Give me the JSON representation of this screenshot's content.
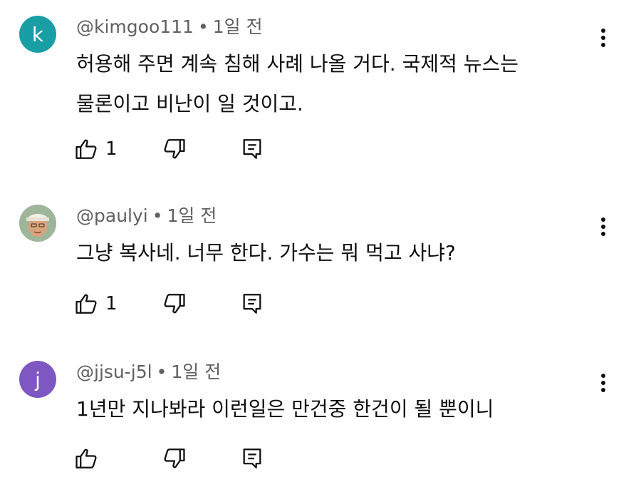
{
  "comments": [
    {
      "avatar_letter": "k",
      "avatar_color": "#1a9ea6",
      "username": "@kimgoo111",
      "time": "1일 전",
      "text_lines": [
        "허용해 주면 계속 침해 사례 나올 거다. 국제적 뉴스는",
        "물론이고 비난이 일 것이고."
      ],
      "likes": "1"
    },
    {
      "avatar_letter": "",
      "avatar_color": "#b8c6b0",
      "username": "@paulyi",
      "time": "1일 전",
      "text_lines": [
        "그냥 복사네. 너무 한다. 가수는 뭐 먹고 사냐?"
      ],
      "likes": "1"
    },
    {
      "avatar_letter": "j",
      "avatar_color": "#7e57c2",
      "username": "@jjsu-j5l",
      "time": "1일 전",
      "text_lines": [
        "1년만 지나봐라 이런일은 만건중 한건이 될 뿐이니"
      ],
      "likes": ""
    }
  ],
  "icons": {
    "like": "thumbs-up-icon",
    "dislike": "thumbs-down-icon",
    "reply": "reply-comment-icon",
    "menu": "more-vertical-icon"
  },
  "separator": "•"
}
